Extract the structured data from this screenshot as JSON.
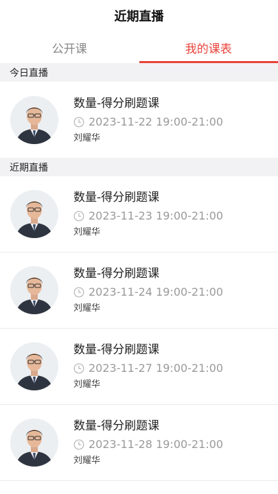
{
  "header": {
    "title": "近期直播"
  },
  "tabs": [
    {
      "label": "公开课",
      "active": false
    },
    {
      "label": "我的课表",
      "active": true
    }
  ],
  "accent_color": "#e8433b",
  "sections": [
    {
      "title": "今日直播",
      "items": [
        {
          "title": "数量-得分刷题课",
          "time": "2023-11-22 19:00-21:00",
          "teacher": "刘耀华",
          "avatar_icon": "teacher-avatar"
        }
      ]
    },
    {
      "title": "近期直播",
      "items": [
        {
          "title": "数量-得分刷题课",
          "time": "2023-11-23 19:00-21:00",
          "teacher": "刘耀华",
          "avatar_icon": "teacher-avatar"
        },
        {
          "title": "数量-得分刷题课",
          "time": "2023-11-24 19:00-21:00",
          "teacher": "刘耀华",
          "avatar_icon": "teacher-avatar"
        },
        {
          "title": "数量-得分刷题课",
          "time": "2023-11-27 19:00-21:00",
          "teacher": "刘耀华",
          "avatar_icon": "teacher-avatar"
        },
        {
          "title": "数量-得分刷题课",
          "time": "2023-11-28 19:00-21:00",
          "teacher": "刘耀华",
          "avatar_icon": "teacher-avatar"
        }
      ]
    }
  ]
}
